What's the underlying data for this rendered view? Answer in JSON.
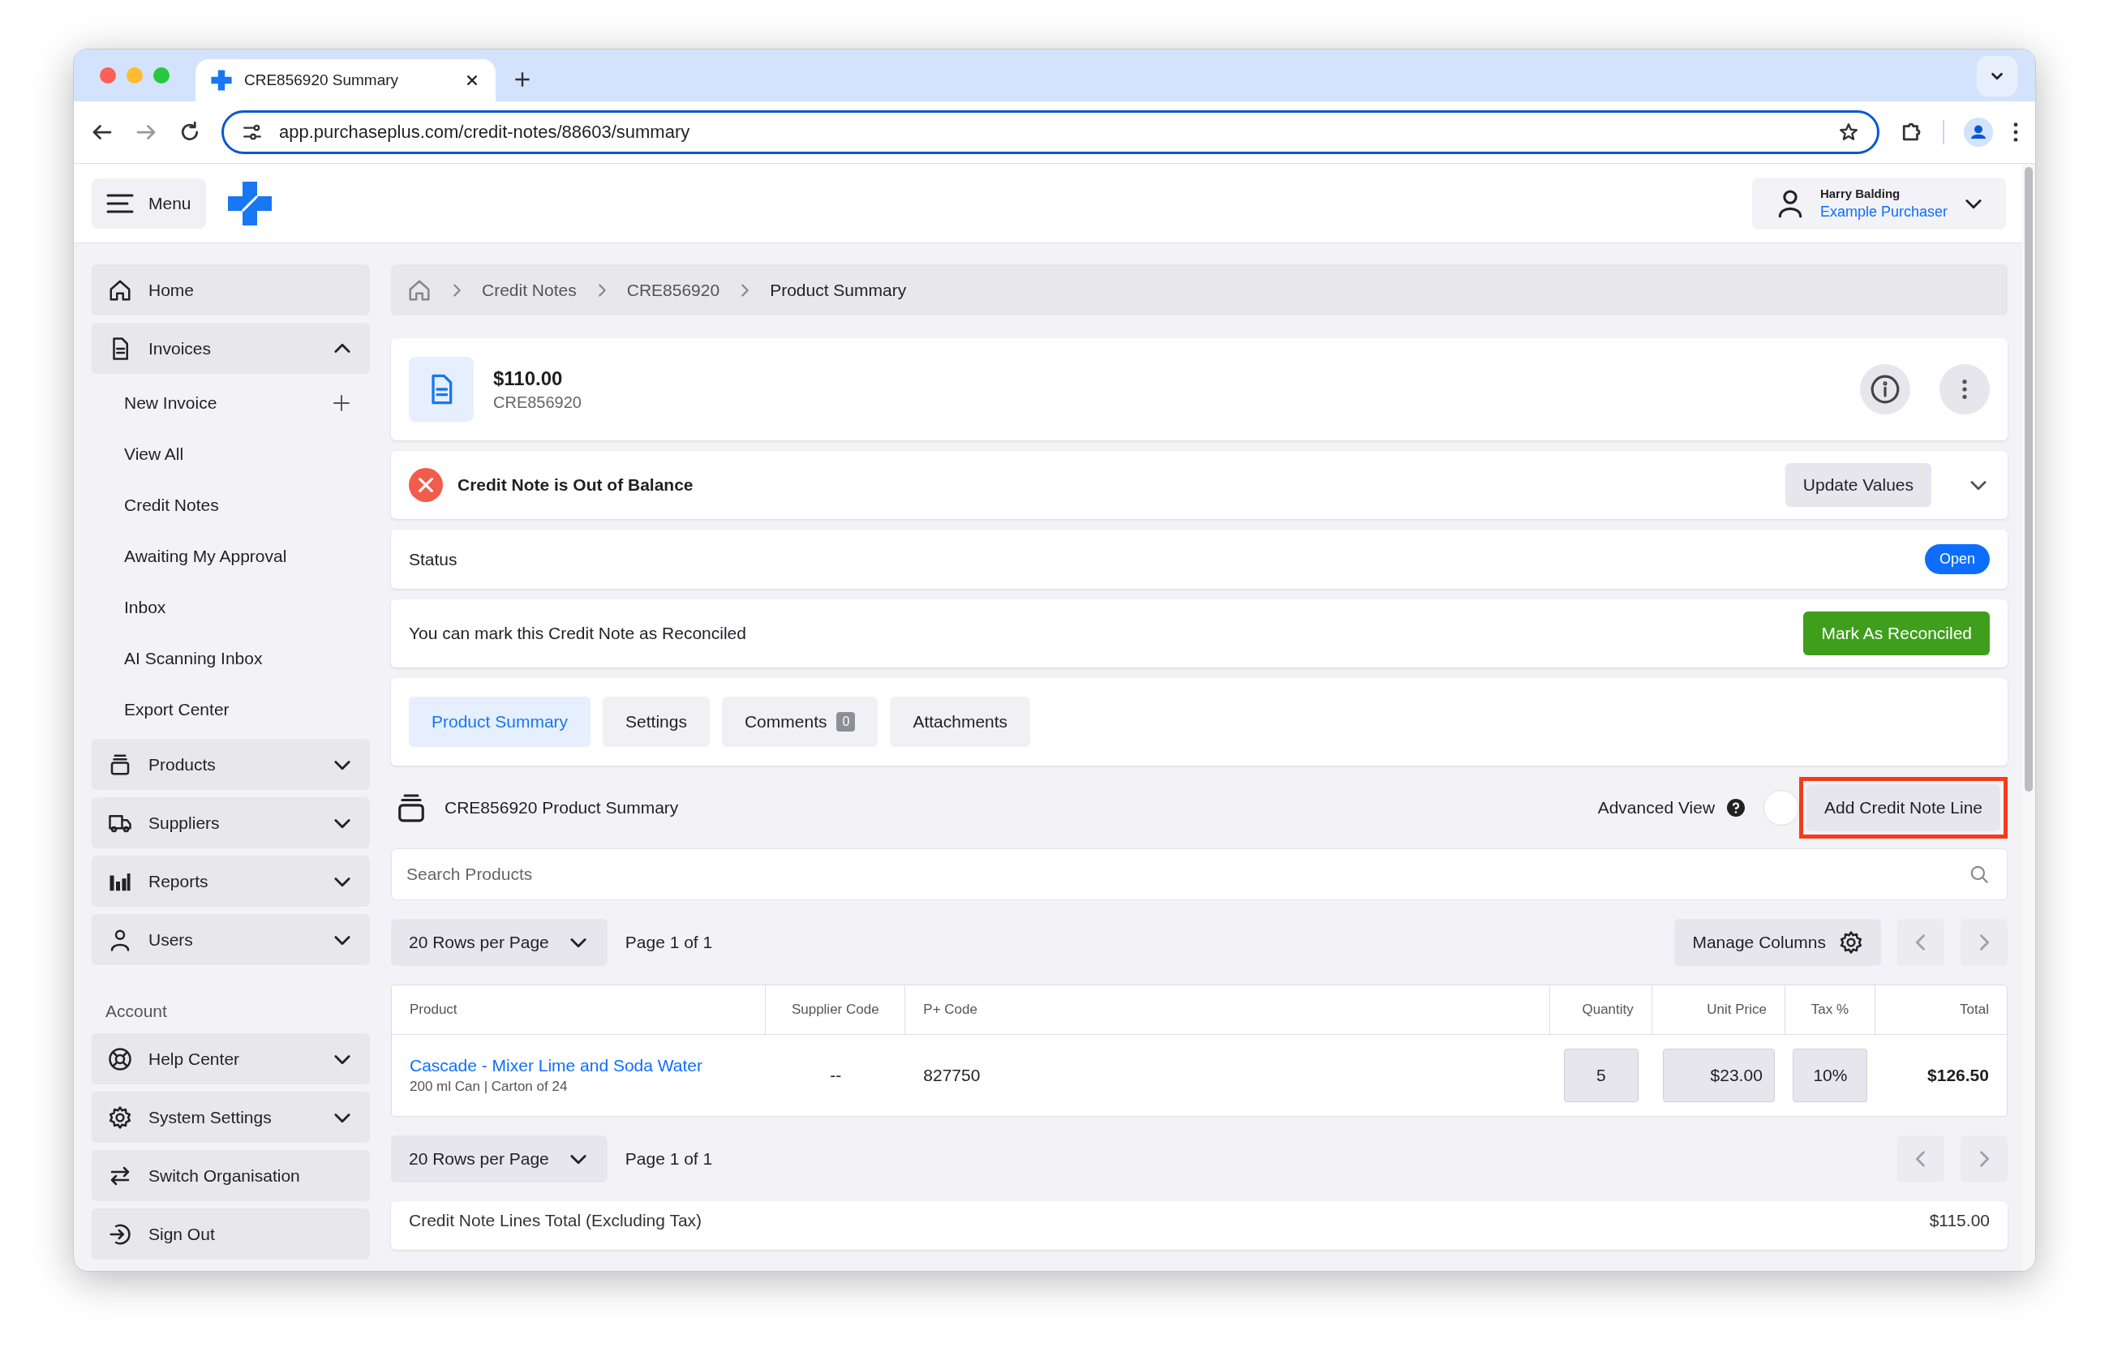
{
  "browser": {
    "tab_title": "CRE856920 Summary",
    "url": "app.purchaseplus.com/credit-notes/88603/summary"
  },
  "header": {
    "menu_label": "Menu",
    "user_name": "Harry Balding",
    "user_role": "Example Purchaser"
  },
  "sidebar": {
    "items": [
      {
        "label": "Home",
        "kind": "link"
      },
      {
        "label": "Invoices",
        "kind": "group",
        "expanded": true,
        "children": [
          {
            "label": "New Invoice",
            "kind": "add"
          },
          {
            "label": "View All",
            "kind": "link"
          },
          {
            "label": "Credit Notes",
            "kind": "link"
          },
          {
            "label": "Awaiting My Approval",
            "kind": "link"
          },
          {
            "label": "Inbox",
            "kind": "link"
          },
          {
            "label": "AI Scanning Inbox",
            "kind": "link"
          },
          {
            "label": "Export Center",
            "kind": "link"
          }
        ]
      },
      {
        "label": "Products",
        "kind": "group",
        "expanded": false
      },
      {
        "label": "Suppliers",
        "kind": "group",
        "expanded": false
      },
      {
        "label": "Reports",
        "kind": "group",
        "expanded": false
      },
      {
        "label": "Users",
        "kind": "group",
        "expanded": false
      }
    ],
    "account_label": "Account",
    "account_items": [
      {
        "label": "Help Center",
        "kind": "group",
        "expanded": false
      },
      {
        "label": "System Settings",
        "kind": "group",
        "expanded": false
      },
      {
        "label": "Switch Organisation",
        "kind": "link"
      },
      {
        "label": "Sign Out",
        "kind": "link"
      }
    ]
  },
  "breadcrumbs": [
    "Credit Notes",
    "CRE856920",
    "Product Summary"
  ],
  "summary": {
    "amount": "$110.00",
    "code": "CRE856920"
  },
  "balance_alert": {
    "message": "Credit Note is Out of Balance",
    "action": "Update Values",
    "expanded": false
  },
  "status": {
    "label": "Status",
    "value": "Open"
  },
  "reconcile": {
    "message": "You can mark this Credit Note as Reconciled",
    "action": "Mark As Reconciled"
  },
  "tabs": [
    {
      "label": "Product Summary",
      "selected": true
    },
    {
      "label": "Settings",
      "selected": false
    },
    {
      "label": "Comments",
      "selected": false,
      "count": "0"
    },
    {
      "label": "Attachments",
      "selected": false
    }
  ],
  "product_summary": {
    "title": "CRE856920 Product Summary",
    "advanced_view_label": "Advanced View",
    "advanced_view_on": false,
    "add_button": "Add Credit Note Line",
    "search_placeholder": "Search Products"
  },
  "pager_top": {
    "rows_per_page": "20 Rows per Page",
    "page": "Page 1 of 1",
    "manage_columns": "Manage Columns"
  },
  "table": {
    "columns": [
      "Product",
      "Supplier Code",
      "P+ Code",
      "Quantity",
      "Unit Price",
      "Tax %",
      "Total"
    ],
    "rows": [
      {
        "product": "Cascade - Mixer Lime and Soda Water",
        "detail": "200 ml Can | Carton of 24",
        "supplier_code": "--",
        "p_code": "827750",
        "quantity": "5",
        "unit_price": "$23.00",
        "tax": "10%",
        "total": "$126.50"
      }
    ]
  },
  "pager_bottom": {
    "rows_per_page": "20 Rows per Page",
    "page": "Page 1 of 1"
  },
  "totals": {
    "label": "Credit Note Lines Total (Excluding Tax)",
    "value": "$115.00"
  }
}
